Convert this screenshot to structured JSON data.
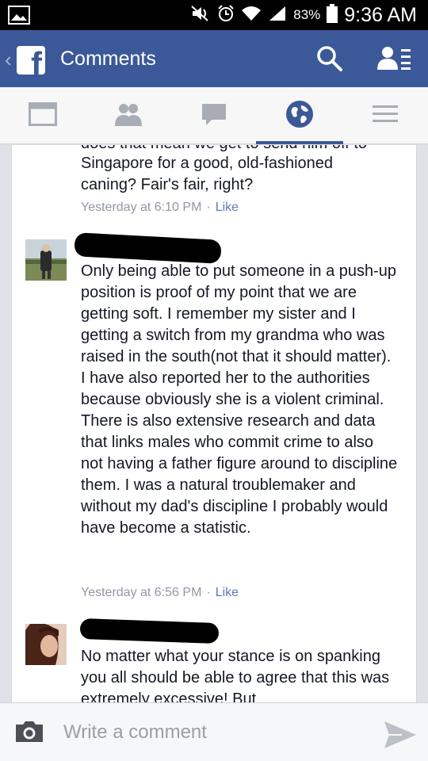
{
  "status_bar": {
    "battery": "83%",
    "time": "9:36 AM"
  },
  "nav": {
    "title": "Comments"
  },
  "tabs": [
    {
      "icon": "news-feed-icon"
    },
    {
      "icon": "friends-icon"
    },
    {
      "icon": "messages-icon"
    },
    {
      "icon": "notifications-globe-icon",
      "active": true
    },
    {
      "icon": "menu-icon"
    }
  ],
  "comments": [
    {
      "cut_line": "does that mean we get to send him off to",
      "text": "Singapore for a good, old-fashioned caning? Fair's fair, right?",
      "time": "Yesterday at 6:10 PM",
      "like": "Like"
    },
    {
      "author_redacted": true,
      "text": "Only being able to put someone in a push-up position is proof of my point that we are getting soft.  I remember my sister and I getting a switch from my grandma who was raised in the south(not that it should matter).  I have also reported her to the authorities because obviously she is a violent criminal.  There is also extensive research and data that links males who commit crime to also not having a father figure around to discipline them.  I was a natural troublemaker and without my dad's discipline I probably would have become a statistic.",
      "time": "Yesterday at 6:56 PM",
      "like": "Like"
    },
    {
      "author_redacted": true,
      "text": "No matter what your stance is on spanking you all should be able to agree that this was extremely excessive! But"
    }
  ],
  "composer": {
    "placeholder": "Write a comment"
  },
  "colors": {
    "brand": "#3b5998",
    "like_link": "#5b7bbd",
    "meta_gray": "#9197a3"
  }
}
